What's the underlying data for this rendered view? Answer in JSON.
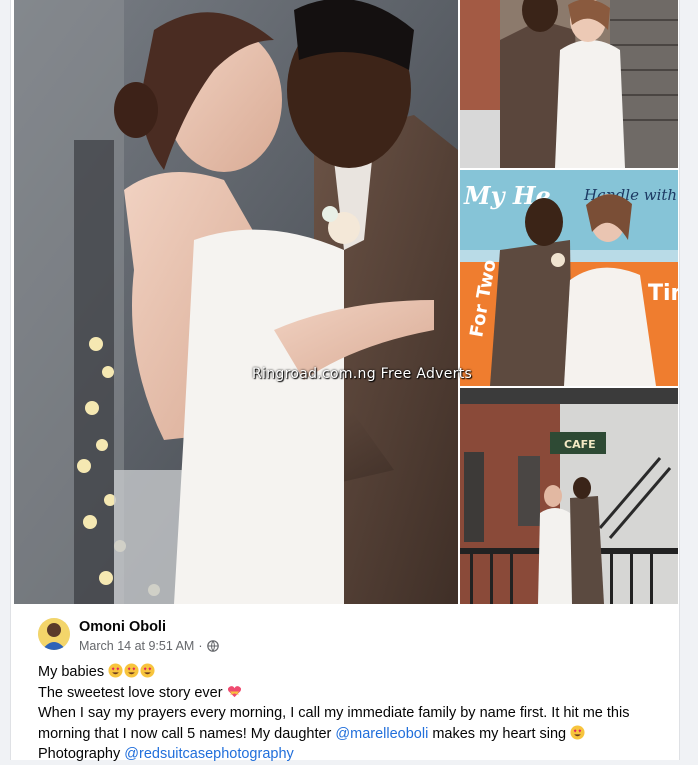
{
  "watermark": "Ringroad.com.ng Free Adverts",
  "post": {
    "author": "Omoni Oboli",
    "timestamp": "March 14 at 9:51 AM",
    "separator": "·",
    "privacy_icon": "globe-icon",
    "lines": {
      "line1": "My babies",
      "line2": "The sweetest love story ever",
      "line3": "When I say my prayers every morning, I call my immediate family by name first. It hit me this",
      "line4_before": "morning that I now call 5 names! My daughter ",
      "line4_mention": "@marelleoboli",
      "line4_after": " makes my heart sing",
      "line5_before": "Photography ",
      "line5_mention": "@redsuitcasephotography"
    },
    "emojis": {
      "line1": [
        "heart-eyes-emoji",
        "heart-eyes-emoji",
        "heart-eyes-emoji"
      ],
      "line2": "heart-with-ribbon-emoji",
      "line4": "heart-eyes-emoji"
    }
  },
  "colors": {
    "background": "#f0f2f5",
    "card": "#ffffff",
    "text": "#050505",
    "secondary_text": "#65676b",
    "mention": "#216fdb"
  },
  "photos": {
    "sign_left": "My He",
    "sign_right": "Handle with",
    "sign_bottom_left": "For Two",
    "sign_bottom_right": "Tim",
    "cafe_sign": "CAFE"
  }
}
